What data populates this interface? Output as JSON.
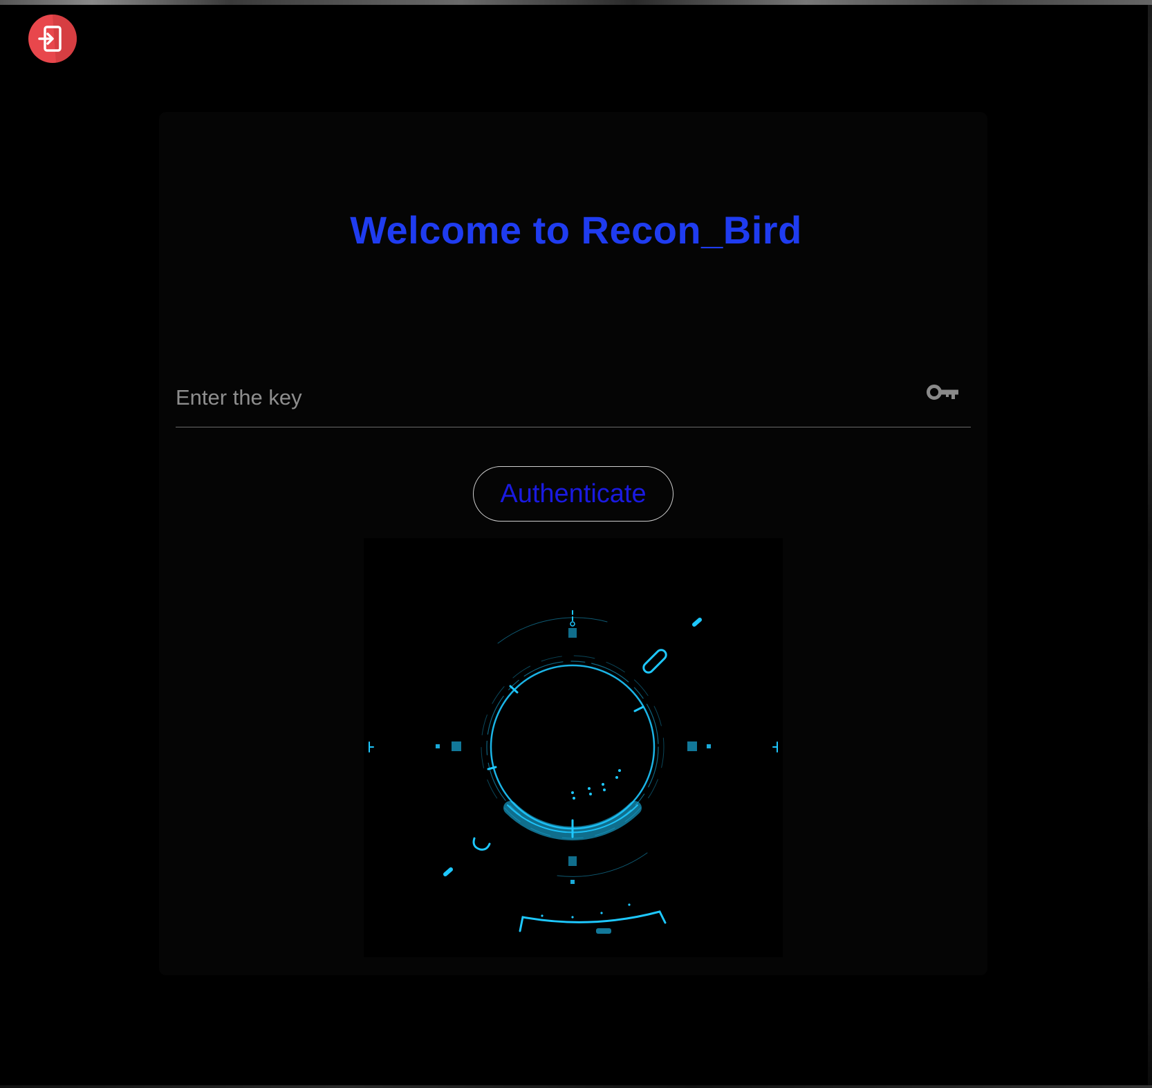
{
  "app": {
    "title": "Welcome to Recon_Bird"
  },
  "login": {
    "key_placeholder": "Enter the key",
    "key_value": "",
    "authenticate_label": "Authenticate"
  },
  "icons": {
    "exit": "exit-to-app-icon",
    "key": "vpn-key-icon"
  },
  "colors": {
    "title": "#1f3cf0",
    "button_text": "#1a1ae0",
    "exit_button": "#e8474c",
    "hud_accent": "#1ec8ff"
  }
}
